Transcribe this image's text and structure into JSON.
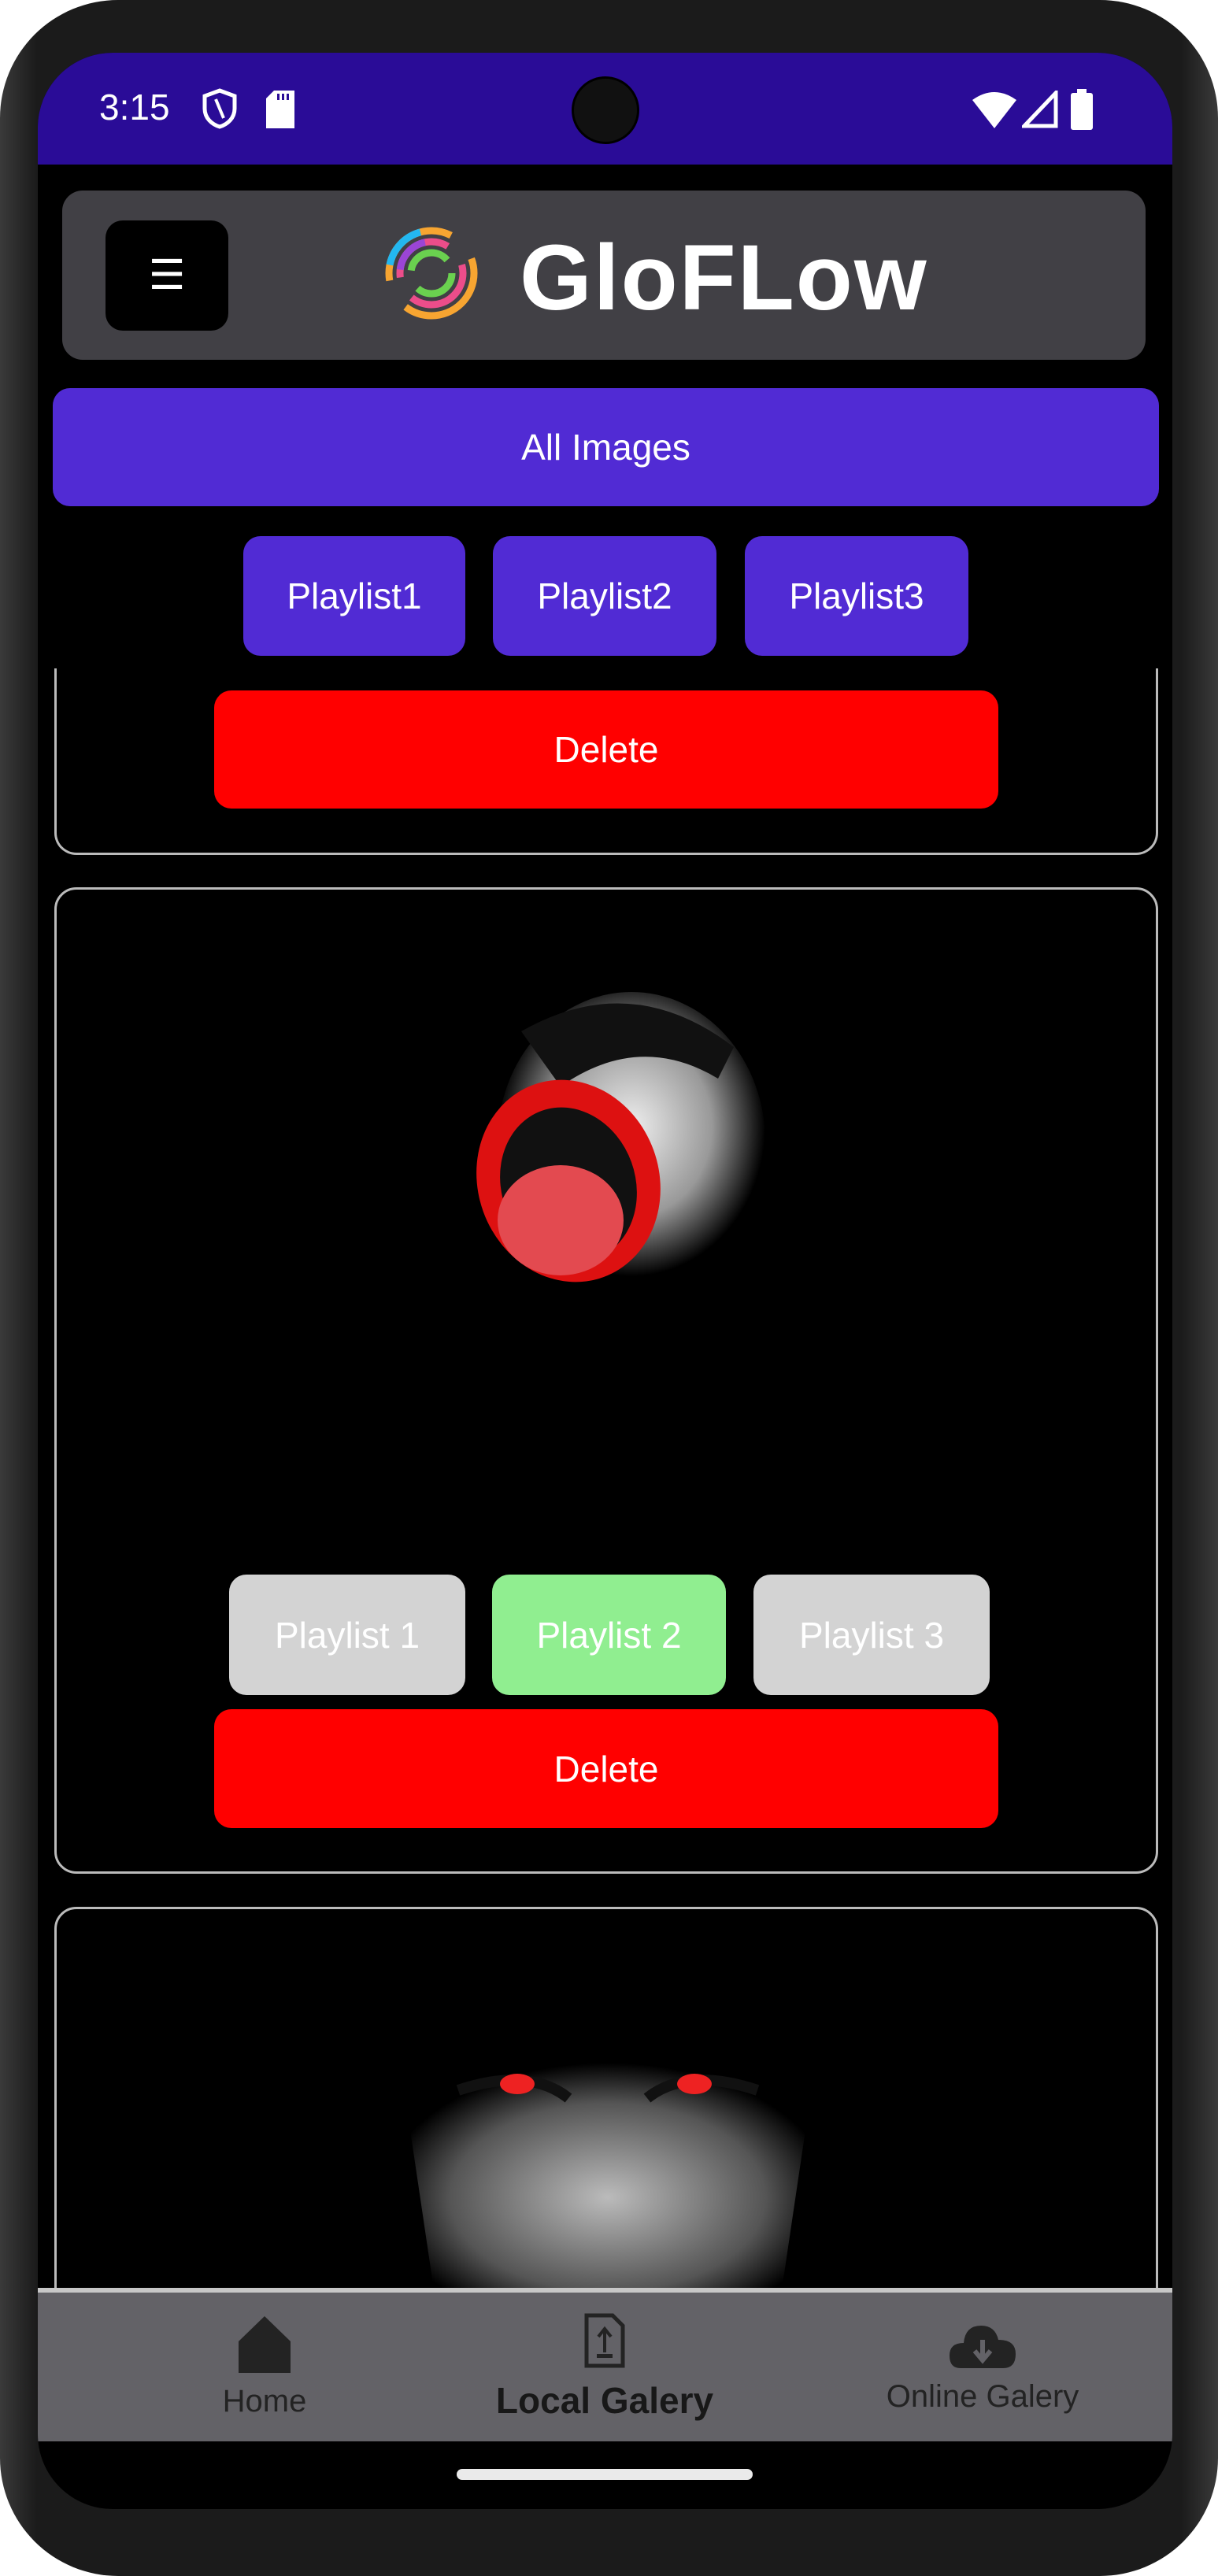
{
  "status_bar": {
    "time": "3:15",
    "icons": [
      "shield-icon",
      "sd-card-icon",
      "wifi-icon",
      "signal-icon",
      "battery-icon"
    ]
  },
  "header": {
    "menu_icon": "☰",
    "brand": "GloFLow"
  },
  "filters": {
    "all_label": "All Images",
    "playlists": [
      "Playlist1",
      "Playlist2",
      "Playlist3"
    ]
  },
  "cards": [
    {
      "delete_label": "Delete"
    },
    {
      "playlists": [
        {
          "label": "Playlist 1",
          "selected": false
        },
        {
          "label": "Playlist 2",
          "selected": true
        },
        {
          "label": "Playlist 3",
          "selected": false
        }
      ],
      "delete_label": "Delete"
    },
    {}
  ],
  "colors": {
    "accent": "#512bd4",
    "status_bar": "#2a0c97",
    "delete": "#ff0000",
    "selected": "#90ee90",
    "unselected": "#d3d3d3"
  },
  "bottom_nav": {
    "items": [
      {
        "label": "Home",
        "icon": "home-icon"
      },
      {
        "label": "Local Galery",
        "icon": "file-upload-icon",
        "active": true
      },
      {
        "label": "Online Galery",
        "icon": "cloud-download-icon"
      }
    ]
  }
}
